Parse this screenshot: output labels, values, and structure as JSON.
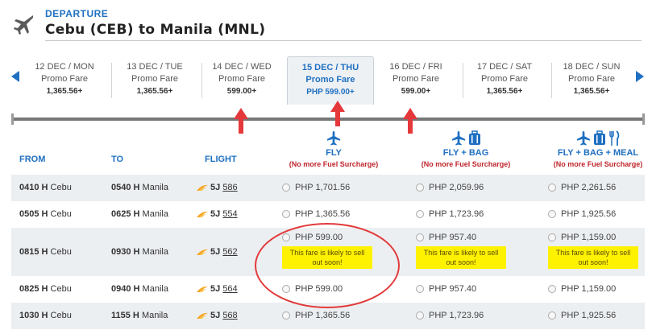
{
  "header": {
    "label": "DEPARTURE",
    "route": "Cebu (CEB) to Manila (MNL)",
    "icon": "airplane-icon"
  },
  "dates": [
    {
      "date": "12 DEC / MON",
      "fare_type": "Promo Fare",
      "amount": "1,365.56+"
    },
    {
      "date": "13 DEC / TUE",
      "fare_type": "Promo Fare",
      "amount": "1,365.56+"
    },
    {
      "date": "14 DEC / WED",
      "fare_type": "Promo Fare",
      "amount": "599.00+"
    },
    {
      "date": "15 DEC / THU",
      "fare_type": "Promo Fare",
      "amount": "PHP 599.00+",
      "selected": true
    },
    {
      "date": "16 DEC / FRI",
      "fare_type": "Promo Fare",
      "amount": "599.00+"
    },
    {
      "date": "17 DEC / SAT",
      "fare_type": "Promo Fare",
      "amount": "1,365.56+"
    },
    {
      "date": "18 DEC / SUN",
      "fare_type": "Promo Fare",
      "amount": "1,365.56+"
    }
  ],
  "columns": {
    "from": "FROM",
    "to": "TO",
    "flight": "FLIGHT",
    "fly": {
      "title": "FLY",
      "note": "(No more Fuel Surcharge)"
    },
    "fly_bag": {
      "title": "FLY + BAG",
      "note": "(No more Fuel Surcharge)"
    },
    "fly_bag_meal": {
      "title": "FLY + BAG + MEAL",
      "note": "(No more Fuel Surcharge)"
    }
  },
  "rows": [
    {
      "dep_time": "0410 H",
      "dep_city": "Cebu",
      "arr_time": "0540 H",
      "arr_city": "Manila",
      "carrier": "5J",
      "number": "586",
      "fly": "PHP 1,701.56",
      "fly_bag": "PHP 2,059.96",
      "fly_bag_meal": "PHP 2,261.56"
    },
    {
      "dep_time": "0505 H",
      "dep_city": "Cebu",
      "arr_time": "0625 H",
      "arr_city": "Manila",
      "carrier": "5J",
      "number": "554",
      "fly": "PHP 1,365.56",
      "fly_bag": "PHP 1,723.96",
      "fly_bag_meal": "PHP 1,925.56"
    },
    {
      "dep_time": "0815 H",
      "dep_city": "Cebu",
      "arr_time": "0930 H",
      "arr_city": "Manila",
      "carrier": "5J",
      "number": "562",
      "fly": "PHP 599.00",
      "fly_bag": "PHP 957.40",
      "fly_bag_meal": "PHP 1,159.00",
      "warning": "This fare is likely to sell out soon!"
    },
    {
      "dep_time": "0825 H",
      "dep_city": "Cebu",
      "arr_time": "0940 H",
      "arr_city": "Manila",
      "carrier": "5J",
      "number": "564",
      "fly": "PHP 599.00",
      "fly_bag": "PHP 957.40",
      "fly_bag_meal": "PHP 1,159.00"
    },
    {
      "dep_time": "1030 H",
      "dep_city": "Cebu",
      "arr_time": "1155 H",
      "arr_city": "Manila",
      "carrier": "5J",
      "number": "568",
      "fly": "PHP 1,365.56",
      "fly_bag": "PHP 1,723.96",
      "fly_bag_meal": "PHP 1,925.56"
    }
  ],
  "colors": {
    "brand_blue": "#1f70c1",
    "warning_yellow": "#fff200",
    "annotation_red": "#e5383b",
    "surcharge_red": "#c0262b"
  }
}
